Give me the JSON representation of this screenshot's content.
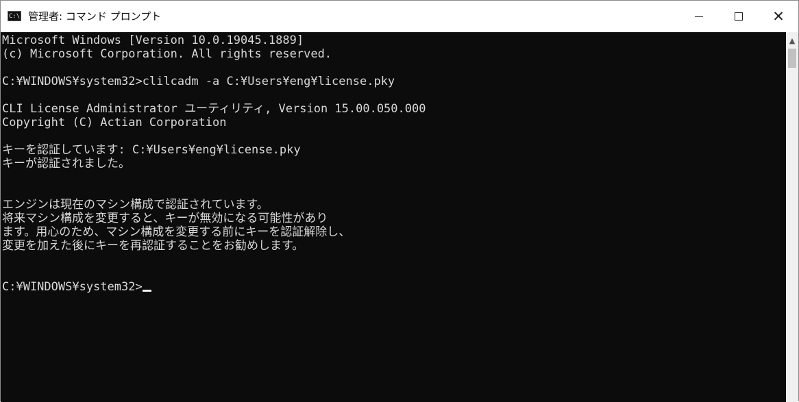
{
  "window": {
    "title": "管理者: コマンド プロンプト",
    "icon_text": "C:\\"
  },
  "controls": {
    "minimize_icon": "minimize-icon",
    "maximize_icon": "maximize-icon",
    "close_icon": "close-icon",
    "close_glyph": "✕"
  },
  "console": {
    "lines": [
      "Microsoft Windows [Version 10.0.19045.1889]",
      "(c) Microsoft Corporation. All rights reserved.",
      "",
      "C:¥WINDOWS¥system32>clilcadm -a C:¥Users¥eng¥license.pky",
      "",
      "CLI License Administrator ユーティリティ, Version 15.00.050.000",
      "Copyright (C) Actian Corporation",
      "",
      "キーを認証しています: C:¥Users¥eng¥license.pky",
      "キーが認証されました。",
      "",
      "",
      "エンジンは現在のマシン構成で認証されています。",
      "将来マシン構成を変更すると、キーが無効になる可能性があり",
      "ます。用心のため、マシン構成を変更する前にキーを認証解除し、",
      "変更を加えた後にキーを再認証することをお勧めします。",
      "",
      "",
      "C:¥WINDOWS¥system32>"
    ]
  },
  "scrollbar": {
    "up_arrow": "▲"
  },
  "colors": {
    "console_bg": "#0c0c0c",
    "console_text": "#d8d8d8",
    "titlebar_bg": "#ffffff"
  }
}
